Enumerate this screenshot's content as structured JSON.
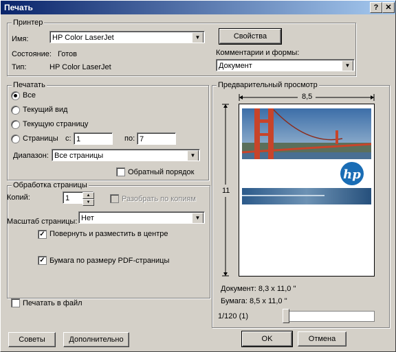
{
  "window": {
    "title": "Печать",
    "help_label": "?",
    "close_label": "✕"
  },
  "printer": {
    "group_label": "Принтер",
    "name_label": "Имя:",
    "name_value": "HP Color LaserJet",
    "status_label": "Состояние:",
    "status_value": "Готов",
    "type_label": "Тип:",
    "type_value": "HP Color LaserJet",
    "properties_button": "Свойства",
    "comments_label": "Комментарии и формы:",
    "comments_value": "Документ"
  },
  "print_range": {
    "group_label": "Печатать",
    "options": [
      "Все",
      "Текущий вид",
      "Текущую страницу",
      "Страницы"
    ],
    "selected": "Все",
    "from_label": "с:",
    "from_value": "1",
    "to_label": "по:",
    "to_value": "7",
    "range_label": "Диапазон:",
    "range_value": "Все страницы",
    "reverse_label": "Обратный порядок"
  },
  "handling": {
    "group_label": "Обработка страницы",
    "copies_label": "Копий:",
    "copies_value": "1",
    "collate_label": "Разобрать по копиям",
    "scale_label": "Масштаб страницы:",
    "scale_value": "Нет",
    "rotate_label": "Повернуть и разместить в центре",
    "rotate_checked": true,
    "pdf_size_label": "Бумага по размеру PDF-страницы",
    "pdf_size_checked": true
  },
  "print_to_file_label": "Печатать в файл",
  "preview": {
    "group_label": "Предварительный просмотр",
    "width_label": "8,5",
    "height_label": "11",
    "document_size": "Документ: 8,3 x 11,0 ''",
    "paper_size": "Бумага: 8,5 x 11,0 ''",
    "page_counter": "1/120 (1)",
    "logo_text": "hp"
  },
  "buttons": {
    "tips": "Советы",
    "advanced": "Дополнительно",
    "ok": "OK",
    "cancel": "Отмена"
  },
  "colors": {
    "title_start": "#0a246a",
    "title_end": "#a6caf0",
    "bridge": "#c8442a",
    "hp_blue": "#1a6db5"
  }
}
